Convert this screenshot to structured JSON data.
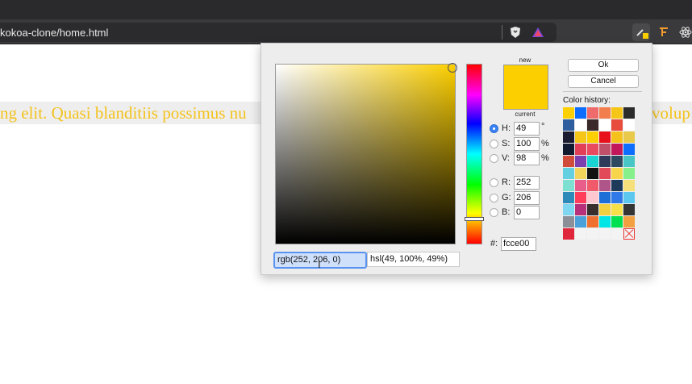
{
  "browser": {
    "url": "kokoa-clone/home.html"
  },
  "page": {
    "text_left": "ng elit. Quasi blanditiis possimus nu",
    "text_right": "volup",
    "text_color": "#f4c21b"
  },
  "picker": {
    "new_label": "new",
    "current_label": "current",
    "selected_color": "#fccf00",
    "fields": {
      "h": {
        "label": "H:",
        "value": "49",
        "unit": "°"
      },
      "s": {
        "label": "S:",
        "value": "100",
        "unit": "%"
      },
      "v": {
        "label": "V:",
        "value": "98",
        "unit": "%"
      },
      "r": {
        "label": "R:",
        "value": "252"
      },
      "g": {
        "label": "G:",
        "value": "206"
      },
      "b": {
        "label": "B:",
        "value": "0"
      }
    },
    "hex_label": "#:",
    "hex_value": "fcce00",
    "rgb_text": "rgb(252, 206, 0)",
    "hsl_text": "hsl(49, 100%, 49%)",
    "ok_label": "Ok",
    "cancel_label": "Cancel",
    "history_label": "Color history:",
    "history_colors": [
      "#fccf00",
      "#0d6efd",
      "#ef6a6a",
      "#f17e4c",
      "#f5c518",
      "#2b2b2b",
      "#2e5e9e",
      "#ffffff",
      "#3a2a2a",
      "#ffffff",
      "#e74c3c",
      "#ffffff",
      "#1b1b2f",
      "#f5c518",
      "#fccf00",
      "#e8101a",
      "#f4c21b",
      "#e8c94a",
      "#121a30",
      "#e23e57",
      "#e84a5f",
      "#c0506a",
      "#c2185b",
      "#0d6efd",
      "#d14b3a",
      "#7b3fb0",
      "#1ad3d3",
      "#2e3a59",
      "#2f4a60",
      "#48c6c6",
      "#62d0e0",
      "#f3d45a",
      "#111111",
      "#e24a5a",
      "#f7d54a",
      "#86f08a",
      "#7ee0d0",
      "#e85d8a",
      "#f05a6a",
      "#b0558a",
      "#1e3a5a",
      "#f5e07a",
      "#2e8ab8",
      "#ff3d5a",
      "#ffc7d0",
      "#1d6fd8",
      "#2f7ae8",
      "#5cc8f0",
      "#7fd6f0",
      "#b8307a",
      "#3a2f2f",
      "#f2d040",
      "#f5e04a",
      "#353535",
      "#8a8f98",
      "#4aa0d8",
      "#f07030",
      "#00e5e5",
      "#00e050",
      "#f2a040",
      "#e0263a",
      "#f3f3f3",
      "#f3f3f3",
      "#f3f3f3",
      "#f3f3f3",
      "empty"
    ]
  }
}
